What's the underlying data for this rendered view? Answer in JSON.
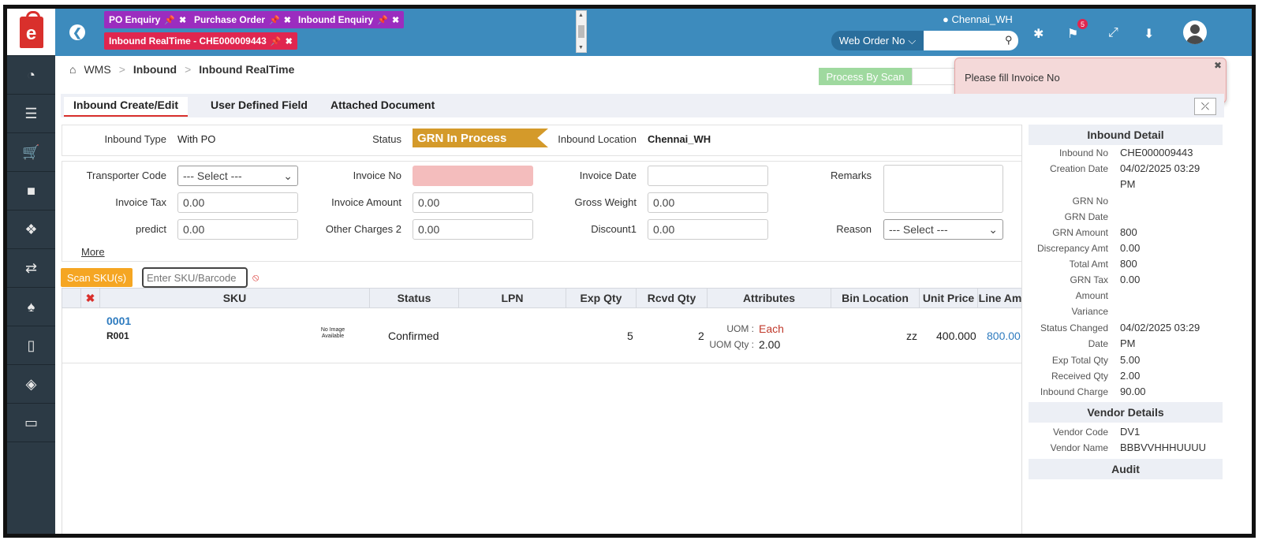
{
  "tabs": [
    "PO Enquiry",
    "Purchase Order",
    "Inbound Enquiry",
    "Inbound RealTime - CHE000009443"
  ],
  "header": {
    "location": "Chennai_WH",
    "search_type": "Web Order No",
    "search_value": "",
    "notification_count": "5"
  },
  "breadcrumb": [
    "WMS",
    "Inbound",
    "Inbound RealTime"
  ],
  "toolbar": {
    "process_by_scan": "Process By Scan"
  },
  "toast": {
    "message": "Please fill Invoice No"
  },
  "content_tabs": [
    "Inbound Create/Edit",
    "User Defined Field",
    "Attached Document"
  ],
  "info": {
    "inbound_type_label": "Inbound Type",
    "inbound_type": "With PO",
    "status_label": "Status",
    "status": "GRN In Process",
    "location_label": "Inbound Location",
    "location": "Chennai_WH"
  },
  "form": {
    "transporter_code_label": "Transporter Code",
    "transporter_code": "--- Select ---",
    "invoice_no_label": "Invoice No",
    "invoice_no": "",
    "invoice_date_label": "Invoice Date",
    "invoice_date": "",
    "remarks_label": "Remarks",
    "remarks": "",
    "invoice_tax_label": "Invoice Tax",
    "invoice_tax": "0.00",
    "invoice_amount_label": "Invoice Amount",
    "invoice_amount": "0.00",
    "gross_weight_label": "Gross Weight",
    "gross_weight": "0.00",
    "predict_label": "predict",
    "predict": "0.00",
    "other_charges_label": "Other Charges 2",
    "other_charges": "0.00",
    "discount_label": "Discount1",
    "discount": "0.00",
    "reason_label": "Reason",
    "reason": "--- Select ---",
    "more_label": "More"
  },
  "scan": {
    "button_label": "Scan SKU(s)",
    "placeholder": "Enter SKU/Barcode"
  },
  "table": {
    "columns": [
      "SKU",
      "Status",
      "LPN",
      "Exp Qty",
      "Rcvd Qty",
      "Attributes",
      "Bin Location",
      "Unit Price",
      "Line Am"
    ],
    "rows": [
      {
        "sku_code": "0001",
        "sku_name": "R001",
        "image_text": "No Image Available",
        "status": "Confirmed",
        "lpn": "",
        "exp_qty": "5",
        "rcvd_qty": "2",
        "uom_label": "UOM :",
        "uom": "Each",
        "uom_qty_label": "UOM Qty :",
        "uom_qty": "2.00",
        "bin_location": "zz",
        "unit_price": "400.000",
        "line_amount": "800.00"
      }
    ]
  },
  "detail": {
    "inbound_title": "Inbound Detail",
    "fields": [
      {
        "label": "Inbound No",
        "value": "CHE000009443"
      },
      {
        "label": "Creation Date",
        "value": "04/02/2025 03:29 PM"
      },
      {
        "label": "GRN No",
        "value": ""
      },
      {
        "label": "GRN Date",
        "value": ""
      },
      {
        "label": "GRN Amount",
        "value": "800"
      },
      {
        "label": "Discrepancy Amt",
        "value": "0.00"
      },
      {
        "label": "Total Amt",
        "value": "800"
      },
      {
        "label": "GRN Tax",
        "value": "0.00"
      },
      {
        "label": "Amount",
        "value": ""
      },
      {
        "label": "Variance",
        "value": ""
      },
      {
        "label": "Status Changed Date",
        "value": "04/02/2025 03:29 PM"
      },
      {
        "label": "Exp Total Qty",
        "value": "5.00"
      },
      {
        "label": "Received Qty",
        "value": "2.00"
      },
      {
        "label": "Inbound Charge",
        "value": "90.00"
      }
    ],
    "vendor_title": "Vendor Details",
    "vendor_fields": [
      {
        "label": "Vendor Code",
        "value": "DV1"
      },
      {
        "label": "Vendor Name",
        "value": "BBBVVHHHUUUU"
      }
    ],
    "audit_title": "Audit"
  }
}
